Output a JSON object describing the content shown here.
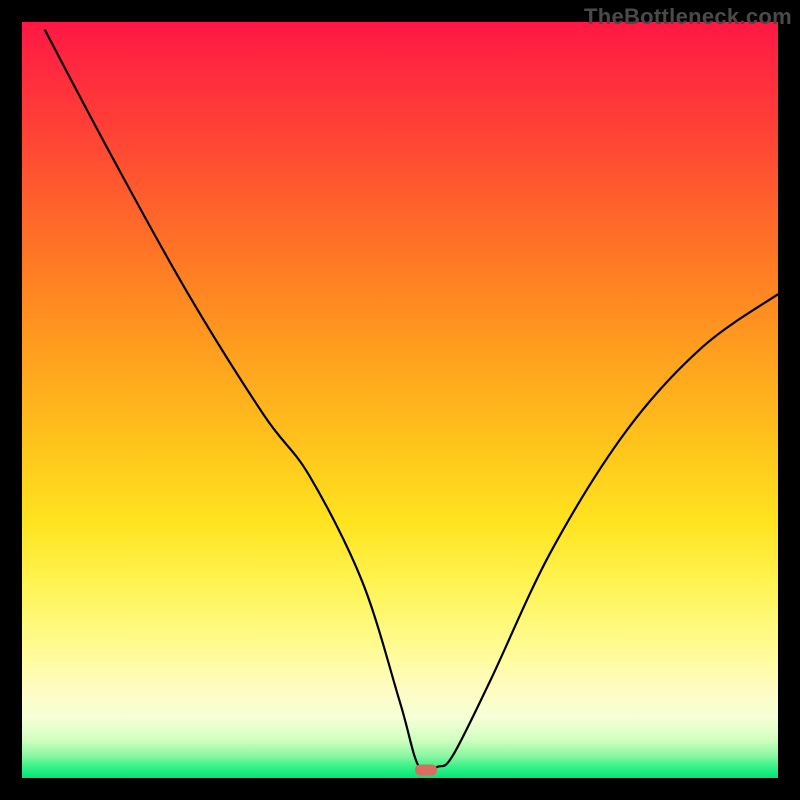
{
  "watermark": "TheBottleneck.com",
  "chart_data": {
    "type": "line",
    "title": "",
    "xlabel": "",
    "ylabel": "",
    "xlim": [
      0,
      100
    ],
    "ylim": [
      0,
      100
    ],
    "grid": false,
    "legend": false,
    "series": [
      {
        "name": "curve",
        "x": [
          3,
          12,
          22,
          32,
          38,
          45,
          50,
          52.5,
          55,
          57,
          62,
          70,
          80,
          90,
          100
        ],
        "values": [
          99,
          82,
          64,
          48,
          40,
          26,
          10,
          1.5,
          1.5,
          3,
          13,
          30,
          46,
          57,
          64
        ]
      }
    ],
    "marker": {
      "x": 53.5,
      "y": 1.0,
      "color": "#d96d63"
    },
    "background_gradient": {
      "top": "#ff1744",
      "mid": "#ffd600",
      "bottom": "#00e676"
    }
  }
}
